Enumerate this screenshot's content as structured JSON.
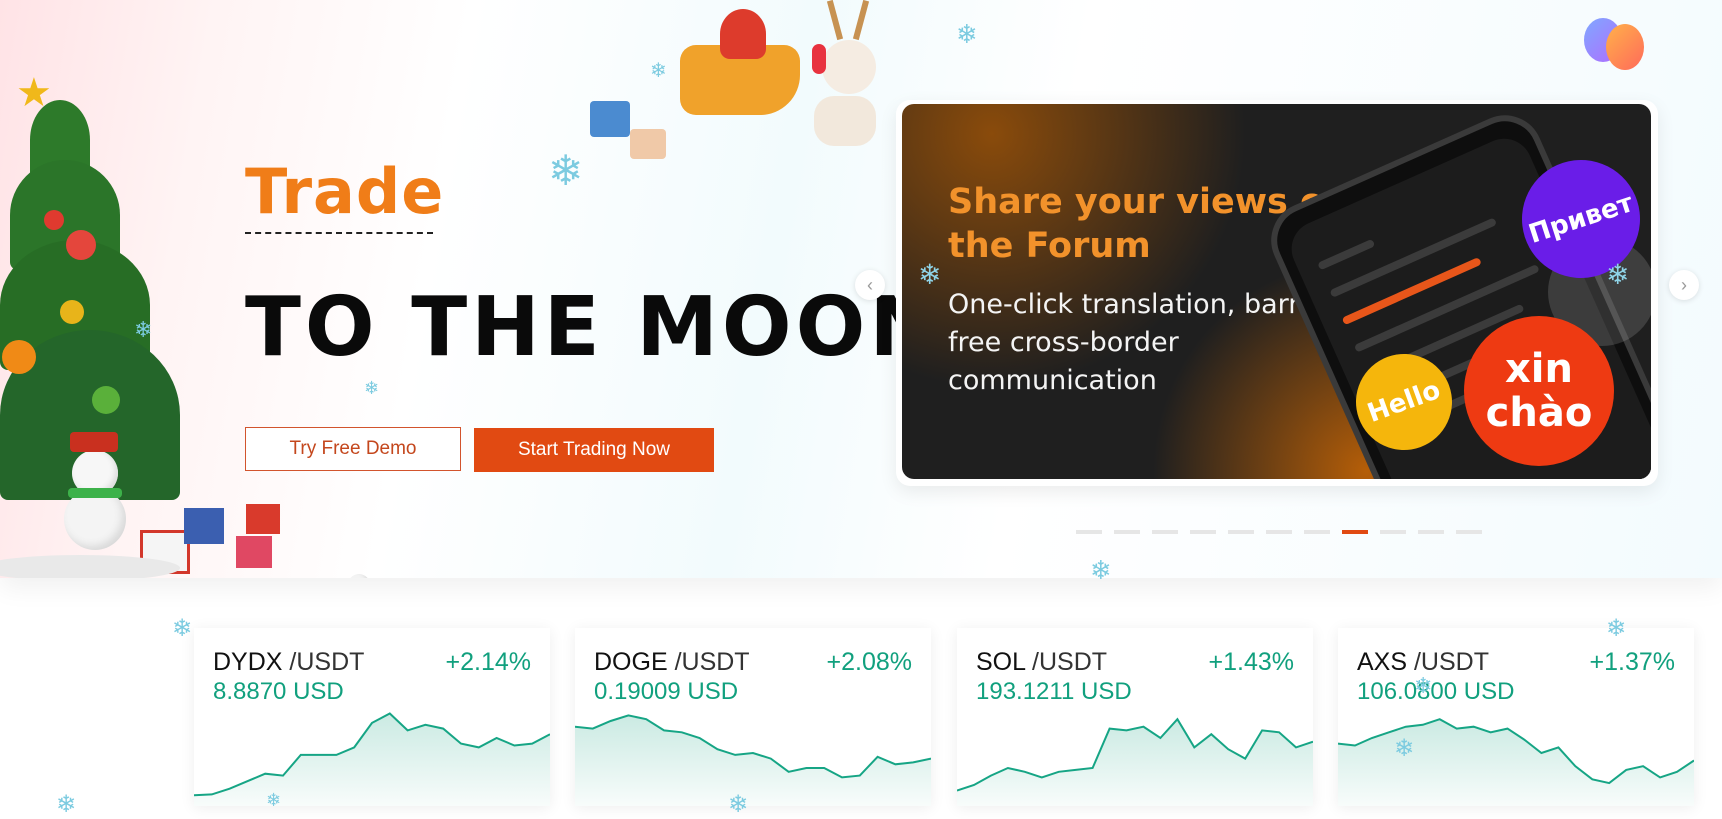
{
  "hero": {
    "headline_accent": "Trade",
    "headline_main": "TO THE MOON",
    "demo_button": "Try Free Demo",
    "start_button": "Start Trading Now"
  },
  "carousel": {
    "banner_title": "Share your views on the Forum",
    "banner_subtitle": "One-click translation, barrier-free cross-border communication",
    "bubbles": {
      "privet": "Привет",
      "xin_chao": "xin chào",
      "hello": "Hello"
    },
    "prev_arrow": "‹",
    "next_arrow": "›",
    "dot_count": 11,
    "active_dot": 7
  },
  "tickers": [
    {
      "base": "DYDX",
      "quote": " /USDT",
      "change": "+2.14%",
      "price": "8.8870 USD",
      "spark": [
        0.05,
        0.06,
        0.12,
        0.2,
        0.28,
        0.26,
        0.48,
        0.48,
        0.48,
        0.56,
        0.82,
        0.92,
        0.74,
        0.8,
        0.76,
        0.6,
        0.56,
        0.66,
        0.58,
        0.6,
        0.7
      ]
    },
    {
      "base": "DOGE",
      "quote": " /USDT",
      "change": "+2.08%",
      "price": "0.19009 USD",
      "spark": [
        0.78,
        0.76,
        0.84,
        0.9,
        0.86,
        0.74,
        0.72,
        0.66,
        0.54,
        0.48,
        0.5,
        0.44,
        0.3,
        0.34,
        0.34,
        0.24,
        0.26,
        0.46,
        0.38,
        0.4,
        0.44
      ]
    },
    {
      "base": "SOL",
      "quote": " /USDT",
      "change": "+1.43%",
      "price": "193.1211 USD",
      "spark": [
        0.1,
        0.16,
        0.26,
        0.34,
        0.3,
        0.24,
        0.3,
        0.32,
        0.34,
        0.76,
        0.74,
        0.78,
        0.66,
        0.86,
        0.56,
        0.7,
        0.54,
        0.44,
        0.74,
        0.72,
        0.56,
        0.62
      ]
    },
    {
      "base": "AXS",
      "quote": " /USDT",
      "change": "+1.37%",
      "price": "106.0800 USD",
      "spark": [
        0.6,
        0.58,
        0.66,
        0.72,
        0.78,
        0.8,
        0.86,
        0.76,
        0.78,
        0.72,
        0.76,
        0.64,
        0.5,
        0.56,
        0.36,
        0.22,
        0.18,
        0.32,
        0.36,
        0.24,
        0.3,
        0.42
      ]
    }
  ],
  "colors": {
    "accent_orange": "#f07d18",
    "cta_red": "#e14a12",
    "positive_green": "#11a07e"
  },
  "icons": [
    "christmas-tree-icon",
    "santa-sleigh-icon",
    "reindeer-icon",
    "balloons-icon",
    "snowman-icon",
    "gift-icon",
    "snowflake-icon",
    "phone-mockup-icon"
  ]
}
